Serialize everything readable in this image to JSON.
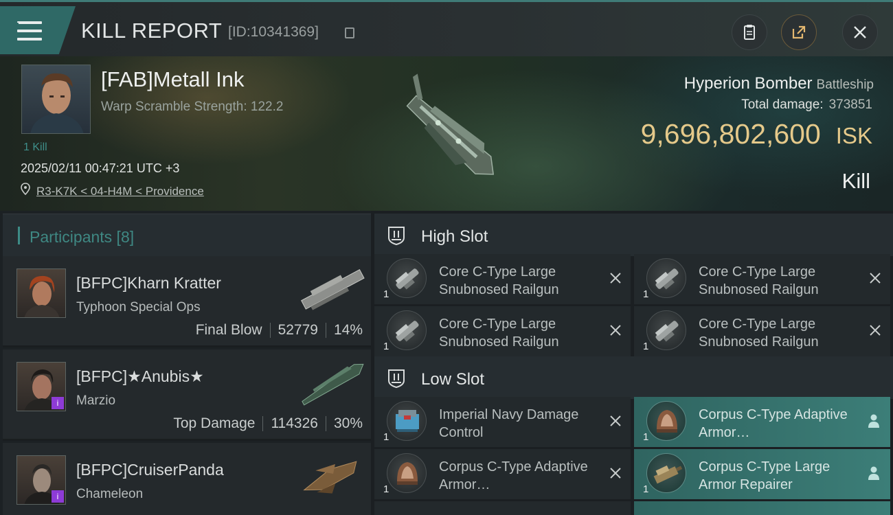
{
  "header": {
    "title": "KILL REPORT",
    "report_id": "[ID:10341369]",
    "accent_color": "#2f6966"
  },
  "victim": {
    "name": "[FAB]Metall Ink",
    "warp_scramble": "Warp Scramble Strength: 122.2",
    "kills_link": "1 Kill",
    "timestamp": "2025/02/11 00:47:21 UTC +3",
    "location": "R3-K7K < 04-H4M < Providence",
    "ship_name": "Hyperion Bomber",
    "ship_class": "Battleship",
    "total_damage_label": "Total damage:",
    "total_damage": "373851",
    "isk_value": "9,696,802,600",
    "isk_unit": "ISK",
    "result": "Kill",
    "isk_color": "#e5c98a"
  },
  "participants": {
    "title": "Participants [8]",
    "items": [
      {
        "name": "[BFPC]Kharn Kratter",
        "ship": "Typhoon Special Ops",
        "label": "Final Blow",
        "damage": "52779",
        "percent": "14%",
        "badge": ""
      },
      {
        "name": "[BFPC]★Anubis★",
        "ship": "Marzio",
        "label": "Top Damage",
        "damage": "114326",
        "percent": "30%",
        "badge": "i"
      },
      {
        "name": "[BFPC]CruiserPanda",
        "ship": "Chameleon",
        "label": "",
        "damage": "",
        "percent": "",
        "badge": "i"
      }
    ]
  },
  "high_slot": {
    "title": "High Slot",
    "modules": [
      {
        "name": "Core C-Type Large Snubnosed Railgun",
        "qty": "1"
      },
      {
        "name": "Core C-Type Large Snubnosed Railgun",
        "qty": "1"
      },
      {
        "name": "Core C-Type Large Snubnosed Railgun",
        "qty": "1"
      },
      {
        "name": "Core C-Type Large Snubnosed Railgun",
        "qty": "1"
      }
    ]
  },
  "low_slot": {
    "title": "Low Slot",
    "modules": [
      {
        "name": "Imperial Navy Damage Control",
        "qty": "1",
        "status": "destroyed"
      },
      {
        "name": "Corpus C-Type Adaptive Armor…",
        "qty": "1",
        "status": "dropped"
      },
      {
        "name": "Corpus C-Type Adaptive Armor…",
        "qty": "1",
        "status": "destroyed"
      },
      {
        "name": "Corpus C-Type Large Armor Repairer",
        "qty": "1",
        "status": "dropped"
      }
    ]
  },
  "icons": {
    "menu": "hamburger-icon",
    "copy": "copy-icon",
    "clipboard": "clipboard-icon",
    "share": "share-icon",
    "close": "close-icon",
    "location": "map-pin-icon",
    "destroyed": "x-mark-icon",
    "dropped": "pilot-icon"
  }
}
